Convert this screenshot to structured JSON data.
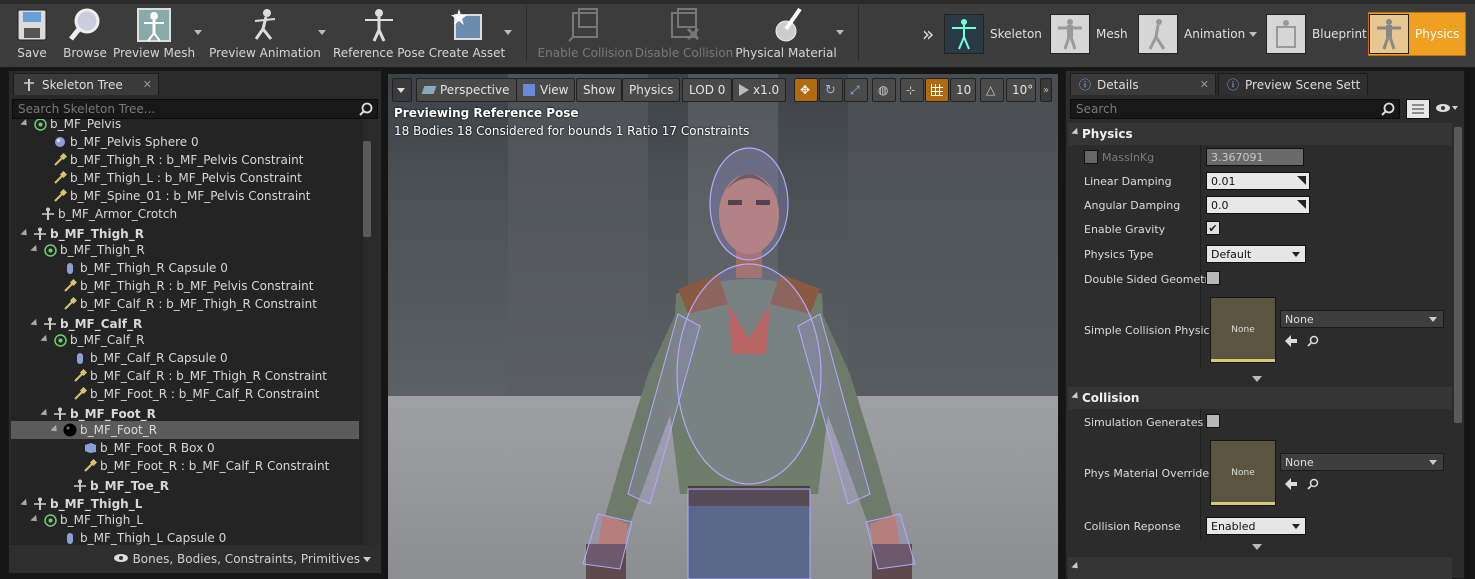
{
  "toolbar": {
    "save": "Save",
    "browse": "Browse",
    "preview_mesh": "Preview Mesh",
    "preview_animation": "Preview Animation",
    "reference_pose": "Reference Pose",
    "create_asset": "Create Asset",
    "enable_collision": "Enable Collision",
    "disable_collision": "Disable Collision",
    "physical_material": "Physical Material"
  },
  "modes": {
    "chevron": "»",
    "skeleton": "Skeleton",
    "mesh": "Mesh",
    "animation": "Animation",
    "blueprint": "Blueprint",
    "physics": "Physics"
  },
  "skeleton_tree": {
    "tab_label": "Skeleton Tree",
    "search_placeholder": "Search Skeleton Tree...",
    "rows": [
      {
        "text": "b_MF_Pelvis",
        "icon": "body-icon",
        "bold": false
      },
      {
        "text": "b_MF_Pelvis Sphere 0",
        "icon": "sphere-icon",
        "bold": false
      },
      {
        "text": "b_MF_Thigh_R : b_MF_Pelvis Constraint",
        "icon": "constraint-icon",
        "bold": false
      },
      {
        "text": "b_MF_Thigh_L : b_MF_Pelvis Constraint",
        "icon": "constraint-icon",
        "bold": false
      },
      {
        "text": "b_MF_Spine_01 : b_MF_Pelvis Constraint",
        "icon": "constraint-icon",
        "bold": false
      },
      {
        "text": "b_MF_Armor_Crotch",
        "icon": "bone-icon",
        "bold": false
      },
      {
        "text": "b_MF_Thigh_R",
        "icon": "bone-icon",
        "bold": true
      },
      {
        "text": "b_MF_Thigh_R",
        "icon": "body-icon",
        "bold": false
      },
      {
        "text": "b_MF_Thigh_R Capsule 0",
        "icon": "capsule-icon",
        "bold": false
      },
      {
        "text": "b_MF_Thigh_R : b_MF_Pelvis Constraint",
        "icon": "constraint-icon",
        "bold": false
      },
      {
        "text": "b_MF_Calf_R : b_MF_Thigh_R Constraint",
        "icon": "constraint-icon",
        "bold": false
      },
      {
        "text": "b_MF_Calf_R",
        "icon": "bone-icon",
        "bold": true
      },
      {
        "text": "b_MF_Calf_R",
        "icon": "body-icon",
        "bold": false
      },
      {
        "text": "b_MF_Calf_R Capsule 0",
        "icon": "capsule-icon",
        "bold": false
      },
      {
        "text": "b_MF_Calf_R : b_MF_Thigh_R Constraint",
        "icon": "constraint-icon",
        "bold": false
      },
      {
        "text": "b_MF_Foot_R : b_MF_Calf_R Constraint",
        "icon": "constraint-icon",
        "bold": false
      },
      {
        "text": "b_MF_Foot_R",
        "icon": "bone-icon",
        "bold": true
      },
      {
        "text": "b_MF_Foot_R",
        "icon": "body-selected-icon",
        "bold": false
      },
      {
        "text": "b_MF_Foot_R Box 0",
        "icon": "box-icon",
        "bold": false
      },
      {
        "text": "b_MF_Foot_R : b_MF_Calf_R Constraint",
        "icon": "constraint-icon",
        "bold": false
      },
      {
        "text": "b_MF_Toe_R",
        "icon": "bone-icon",
        "bold": true
      },
      {
        "text": "b_MF_Thigh_L",
        "icon": "bone-icon",
        "bold": true
      },
      {
        "text": "b_MF_Thigh_L",
        "icon": "body-icon",
        "bold": false
      },
      {
        "text": "b_MF_Thigh_L Capsule 0",
        "icon": "capsule-icon",
        "bold": false
      }
    ],
    "filter_label": "Bones, Bodies, Constraints, Primitives"
  },
  "viewport": {
    "perspective": "Perspective",
    "view": "View",
    "show": "Show",
    "physics": "Physics",
    "lod": "LOD 0",
    "speed": "x1.0",
    "grid_size": "10",
    "rot_snap": "10°",
    "info_line1": "Previewing Reference Pose",
    "info_line2": "18 Bodies  18 Considered for bounds  1 Ratio  17 Constraints"
  },
  "details": {
    "tab_details": "Details",
    "tab_preview": "Preview Scene Sett",
    "search_placeholder": "Search",
    "physics_header": "Physics",
    "mass_label": "MassInKg",
    "mass_value": "3.367091",
    "linear_damping_label": "Linear Damping",
    "linear_damping_value": "0.01",
    "angular_damping_label": "Angular Damping",
    "angular_damping_value": "0.0",
    "enable_gravity_label": "Enable Gravity",
    "physics_type_label": "Physics Type",
    "physics_type_value": "Default",
    "double_sided_label": "Double Sided Geometry",
    "simple_collision_label": "Simple Collision Physic",
    "simple_collision_material": "None",
    "simple_collision_thumb": "None",
    "collision_header": "Collision",
    "sim_generates_label": "Simulation Generates H",
    "phys_override_label": "Phys Material Override",
    "phys_override_value": "None",
    "phys_override_thumb": "None",
    "collision_response_label": "Collision Reponse",
    "collision_response_value": "Enabled"
  },
  "colors": {
    "accent_orange": "#f0a020",
    "panel_bg": "#2c2c2c",
    "selection": "#5b5b5b"
  }
}
